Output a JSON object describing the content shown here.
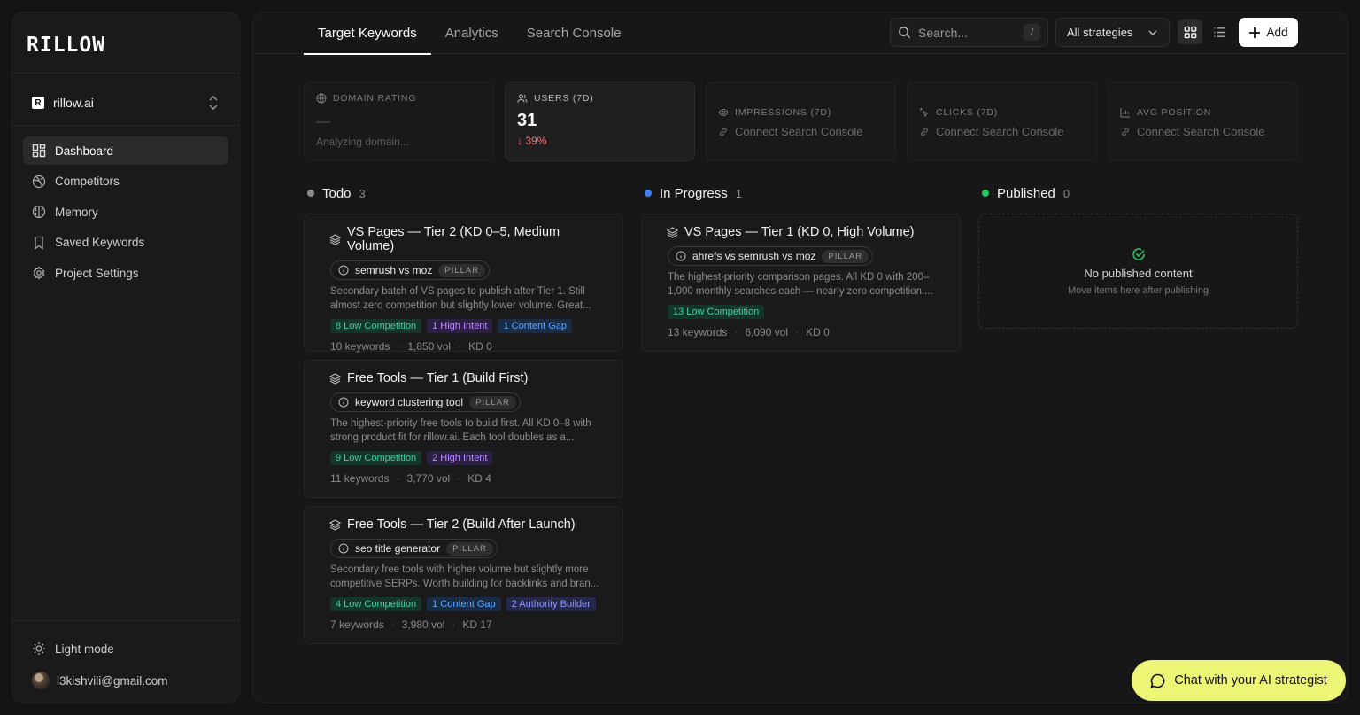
{
  "sidebar": {
    "logo": "RILLOW",
    "project": {
      "icon_letter": "R",
      "name": "rillow.ai"
    },
    "nav": [
      {
        "label": "Dashboard",
        "icon": "dashboard-icon",
        "active": true
      },
      {
        "label": "Competitors",
        "icon": "globe-icon"
      },
      {
        "label": "Memory",
        "icon": "brain-icon"
      },
      {
        "label": "Saved Keywords",
        "icon": "bookmark-icon"
      },
      {
        "label": "Project Settings",
        "icon": "gear-icon"
      }
    ],
    "light_mode": "Light mode",
    "user_email": "l3kishvili@gmail.com"
  },
  "topbar": {
    "tabs": [
      "Target Keywords",
      "Analytics",
      "Search Console"
    ],
    "active_tab": 0,
    "search_placeholder": "Search...",
    "search_shortcut": "/",
    "strategy_filter": "All strategies",
    "add_label": "Add"
  },
  "stats": {
    "domain_rating": {
      "label": "DOMAIN RATING",
      "value": "—",
      "sub": "Analyzing domain..."
    },
    "users": {
      "label": "USERS (7D)",
      "value": "31",
      "delta": "39%"
    },
    "impressions": {
      "label": "IMPRESSIONS (7D)",
      "connect": "Connect Search Console"
    },
    "clicks": {
      "label": "CLICKS (7D)",
      "connect": "Connect Search Console"
    },
    "avg_position": {
      "label": "AVG POSITION",
      "connect": "Connect Search Console"
    }
  },
  "columns": {
    "todo": {
      "title": "Todo",
      "count": "3",
      "color": "#8a8a8a"
    },
    "in_progress": {
      "title": "In Progress",
      "count": "1",
      "color": "#3b82f6"
    },
    "published": {
      "title": "Published",
      "count": "0",
      "color": "#22c55e"
    }
  },
  "cards": {
    "c1": {
      "title": "VS Pages — Tier 2 (KD 0–5, Medium Volume)",
      "keyword": "semrush vs moz",
      "pillar": "PILLAR",
      "desc1": "Secondary batch of VS pages to publish after Tier 1. Still",
      "desc2": "almost zero competition but slightly lower volume. Great...",
      "tags": [
        "8 Low Competition",
        "1 High Intent",
        "1 Content Gap"
      ],
      "keywords": "10 keywords",
      "vol": "1,850 vol",
      "kd": "KD 0"
    },
    "c2": {
      "title": "Free Tools — Tier 1 (Build First)",
      "keyword": "keyword clustering tool",
      "pillar": "PILLAR",
      "desc1": "The highest-priority free tools to build first. All KD 0–8 with",
      "desc2": "strong product fit for rillow.ai. Each tool doubles as a...",
      "tags": [
        "9 Low Competition",
        "2 High Intent"
      ],
      "keywords": "11 keywords",
      "vol": "3,770 vol",
      "kd": "KD 4"
    },
    "c3": {
      "title": "Free Tools — Tier 2 (Build After Launch)",
      "keyword": "seo title generator",
      "pillar": "PILLAR",
      "desc1": "Secondary free tools with higher volume but slightly more",
      "desc2": "competitive SERPs. Worth building for backlinks and bran...",
      "tags": [
        "4 Low Competition",
        "1 Content Gap",
        "2 Authority Builder"
      ],
      "keywords": "7 keywords",
      "vol": "3,980 vol",
      "kd": "KD 17"
    },
    "c4": {
      "title": "VS Pages — Tier 1 (KD 0, High Volume)",
      "keyword": "ahrefs vs semrush vs moz",
      "pillar": "PILLAR",
      "desc1": "The highest-priority comparison pages. All KD 0 with 200–",
      "desc2": "1,000 monthly searches each — nearly zero competition....",
      "tags": [
        "13 Low Competition"
      ],
      "keywords": "13 keywords",
      "vol": "6,090 vol",
      "kd": "KD 0"
    }
  },
  "published_empty": {
    "title": "No published content",
    "sub": "Move items here after publishing"
  },
  "chat": {
    "label": "Chat with your AI strategist"
  },
  "colors": {
    "accent_chat": "#edf576",
    "delta_down": "#f87171",
    "tag_green": "#3fd4a0",
    "tag_purple": "#b88cff",
    "tag_blue": "#5fa8ff",
    "tag_indigo": "#8f96ff"
  }
}
